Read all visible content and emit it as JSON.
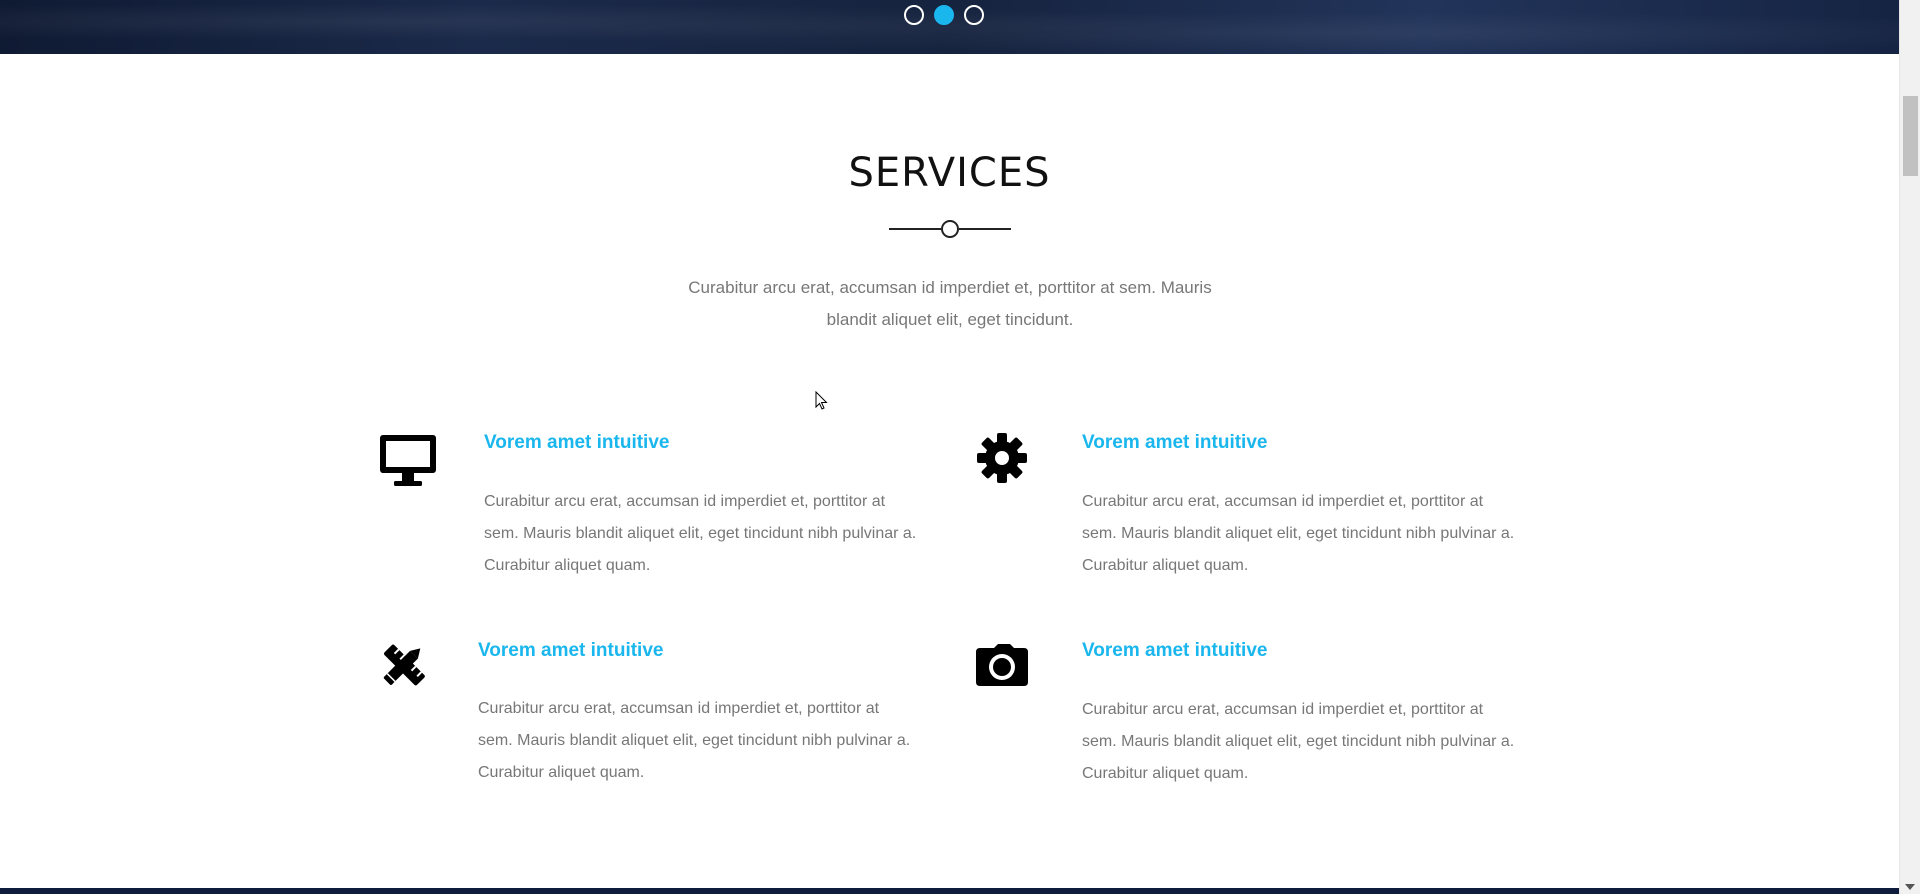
{
  "carousel": {
    "dots": [
      {
        "label": "slide-1",
        "active": false
      },
      {
        "label": "slide-2",
        "active": true
      },
      {
        "label": "slide-3",
        "active": false
      }
    ],
    "active_color": "#1ab6ee"
  },
  "services": {
    "heading": "SERVICES",
    "intro": "Curabitur arcu erat, accumsan id imperdiet et, porttitor at sem. Mauris blandit aliquet elit, eget tincidunt.",
    "items": [
      {
        "icon": "desktop-monitor-icon",
        "title": "Vorem amet intuitive",
        "text": "Curabitur arcu erat, accumsan id imperdiet et, porttitor at sem. Mauris blandit aliquet elit, eget tincidunt nibh pulvinar a. Curabitur aliquet quam."
      },
      {
        "icon": "gear-icon",
        "title": "Vorem amet intuitive",
        "text": "Curabitur arcu erat, accumsan id imperdiet et, porttitor at sem. Mauris blandit aliquet elit, eget tincidunt nibh pulvinar a. Curabitur aliquet quam."
      },
      {
        "icon": "pencil-ruler-icon",
        "title": "Vorem amet intuitive",
        "text": "Curabitur arcu erat, accumsan id imperdiet et, porttitor at sem. Mauris blandit aliquet elit, eget tincidunt nibh pulvinar a. Curabitur aliquet quam."
      },
      {
        "icon": "camera-icon",
        "title": "Vorem amet intuitive",
        "text": "Curabitur arcu erat, accumsan id imperdiet et, porttitor at sem. Mauris blandit aliquet elit, eget tincidunt nibh pulvinar a. Curabitur aliquet quam."
      }
    ]
  },
  "colors": {
    "accent": "#1ab6ee",
    "text_muted": "#777777",
    "heading": "#111111"
  }
}
